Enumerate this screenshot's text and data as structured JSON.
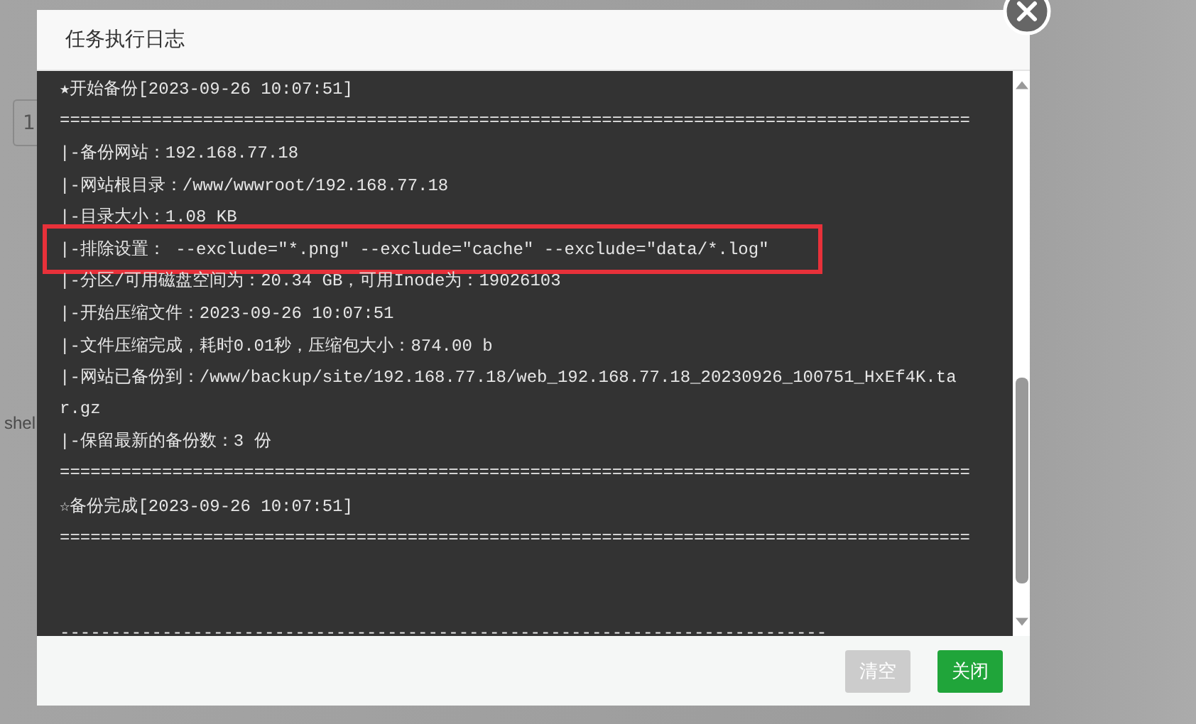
{
  "background": {
    "page_input": "1",
    "page_text": "shel"
  },
  "dialog": {
    "title": "任务执行日志",
    "log_lines": [
      {
        "kind": "text",
        "text": "★开始备份[2023-09-26 10:07:51]"
      },
      {
        "kind": "text",
        "text": "========================================================================================="
      },
      {
        "kind": "text",
        "text": "|-备份网站：192.168.77.18"
      },
      {
        "kind": "text",
        "text": "|-网站根目录：/www/wwwroot/192.168.77.18"
      },
      {
        "kind": "text",
        "text": "|-目录大小：1.08 KB"
      },
      {
        "kind": "highlight",
        "text": "|-排除设置： --exclude=″*.png″ --exclude=″cache″ --exclude=″data/*.log″"
      },
      {
        "kind": "text",
        "text": "|-分区/可用磁盘空间为：20.34 GB，可用Inode为：19026103"
      },
      {
        "kind": "text",
        "text": "|-开始压缩文件：2023-09-26 10:07:51"
      },
      {
        "kind": "text",
        "text": "|-文件压缩完成，耗时0.01秒，压缩包大小：874.00 b"
      },
      {
        "kind": "text",
        "text": "|-网站已备份到：/www/backup/site/192.168.77.18/web_192.168.77.18_20230926_100751_HxEf4K.ta"
      },
      {
        "kind": "text",
        "text": "r.gz"
      },
      {
        "kind": "text",
        "text": "|-保留最新的备份数：3 份"
      },
      {
        "kind": "text",
        "text": "========================================================================================="
      },
      {
        "kind": "text",
        "text": "☆备份完成[2023-09-26 10:07:51]"
      },
      {
        "kind": "text",
        "text": "========================================================================================="
      },
      {
        "kind": "blank"
      },
      {
        "kind": "blank"
      },
      {
        "kind": "text",
        "text": "---------------------------------------------------------------------------"
      }
    ],
    "buttons": [
      {
        "label": "清空",
        "kind": "secondary"
      },
      {
        "label": "关闭",
        "kind": "primary"
      }
    ]
  }
}
